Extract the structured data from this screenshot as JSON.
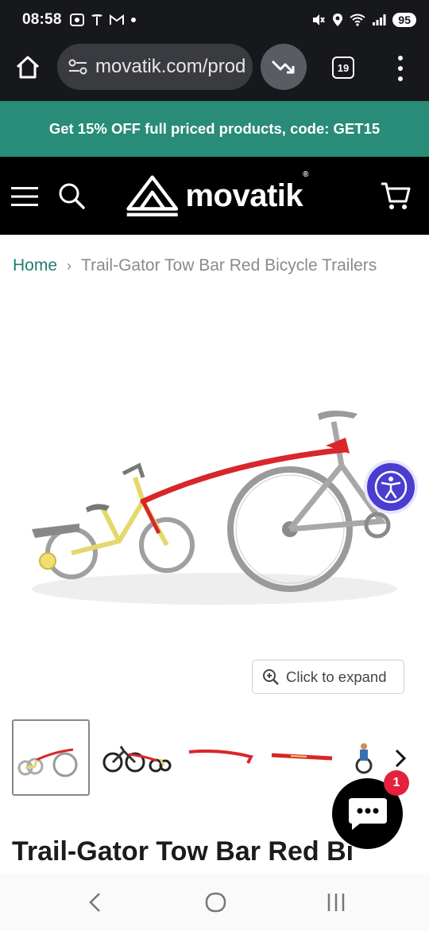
{
  "status_bar": {
    "time": "08:58",
    "battery": "95",
    "left_icons": [
      "screenshot-icon",
      "tesla-icon",
      "gmail-icon",
      "dot-icon"
    ],
    "right_icons": [
      "mute-icon",
      "location-icon",
      "wifi-icon",
      "signal-icon"
    ]
  },
  "browser": {
    "url": "movatik.com/prod",
    "tab_count": "19"
  },
  "promo": {
    "text": "Get 15% OFF full priced products, code: GET15"
  },
  "header": {
    "logo_text": "movatik",
    "logo_mark": "®"
  },
  "breadcrumb": {
    "home": "Home",
    "separator": "›",
    "current": "Trail-Gator Tow Bar Red Bicycle Trailers"
  },
  "product": {
    "expand_label": "Click to expand",
    "title": "Trail-Gator Tow Bar Red Bicycle Trailers"
  },
  "chat": {
    "badge": "1"
  },
  "colors": {
    "promo_bg": "#288c78",
    "accessibility_bg": "#4a3dd0",
    "breadcrumb_link": "#1f7e72",
    "badge": "#e4223b"
  }
}
